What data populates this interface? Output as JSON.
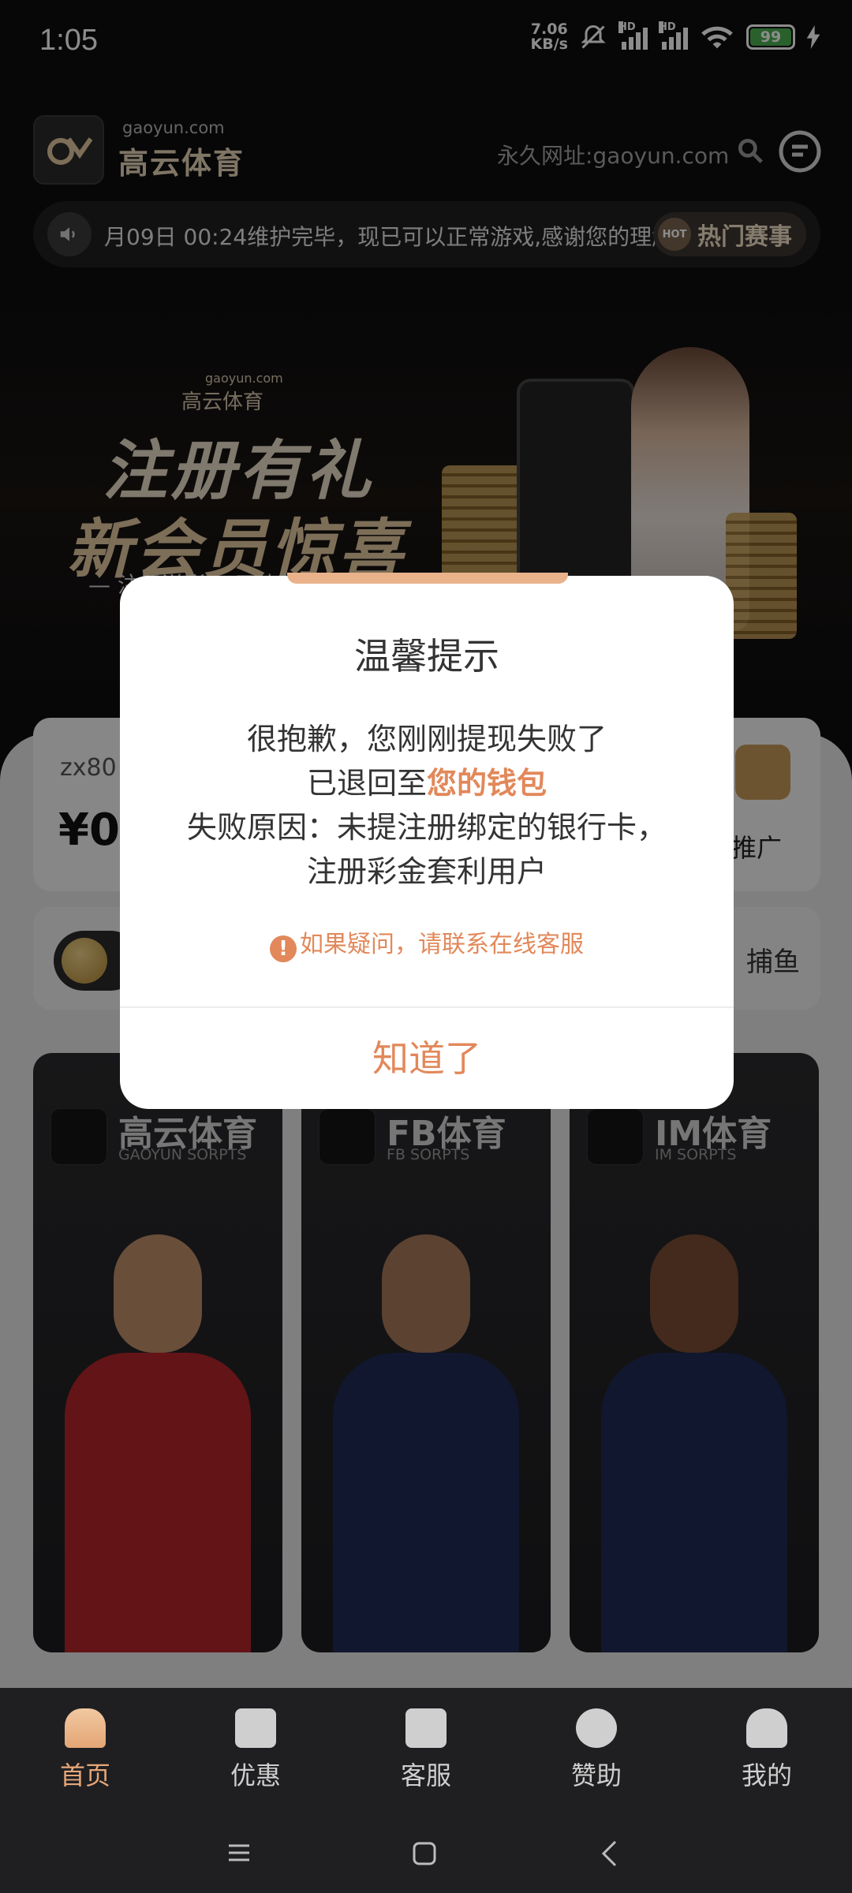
{
  "status_bar": {
    "time": "1:05",
    "net_speed_value": "7.06",
    "net_speed_unit": "KB/s",
    "sig1_label": "HD",
    "sig2_label": "HD",
    "wifi_label": "6",
    "battery": "99"
  },
  "header": {
    "logo_domain": "gaoyun.com",
    "logo_name": "高云体育",
    "permanent_url": "永久网址:gaoyun.com"
  },
  "marquee": {
    "text": "月09日 00:24维护完毕，现已可以正常游戏,感谢您的理解",
    "hot_badge": "HOT",
    "hot_label": "热门赛事"
  },
  "banner": {
    "brand_domain": "gaoyun.com",
    "brand_name": "高云体育",
    "line1": "注册有礼",
    "line2": "新会员惊喜",
    "subline": "— 注册送彩88元体验金"
  },
  "wallet": {
    "username": "zx80",
    "amount": "¥0.",
    "promo_label": "推广"
  },
  "game_tabs": {
    "fishing": "捕鱼"
  },
  "sports": [
    {
      "name": "高云体育",
      "en": "GAOYUN SORPTS"
    },
    {
      "name": "FB体育",
      "en": "FB SORPTS"
    },
    {
      "name": "IM体育",
      "en": "IM SORPTS"
    }
  ],
  "modal": {
    "title": "温馨提示",
    "line1": "很抱歉，您刚刚提现失败了",
    "line2_prefix": "已退回至",
    "line2_highlight": "您的钱包",
    "line3": "失败原因：未提注册绑定的银行卡，",
    "line4": "注册彩金套利用户",
    "warning": "如果疑问，请联系在线客服",
    "confirm": "知道了"
  },
  "bottom_nav": [
    {
      "label": "首页",
      "icon": "home-icon",
      "active": true
    },
    {
      "label": "优惠",
      "icon": "discount-icon",
      "active": false
    },
    {
      "label": "客服",
      "icon": "service-icon",
      "active": false
    },
    {
      "label": "赞助",
      "icon": "sponsor-icon",
      "active": false
    },
    {
      "label": "我的",
      "icon": "profile-icon",
      "active": false
    }
  ],
  "colors": {
    "accent": "#e2885a",
    "nav_bg": "#1f1f21",
    "page_bg": "#0d0d0f"
  }
}
